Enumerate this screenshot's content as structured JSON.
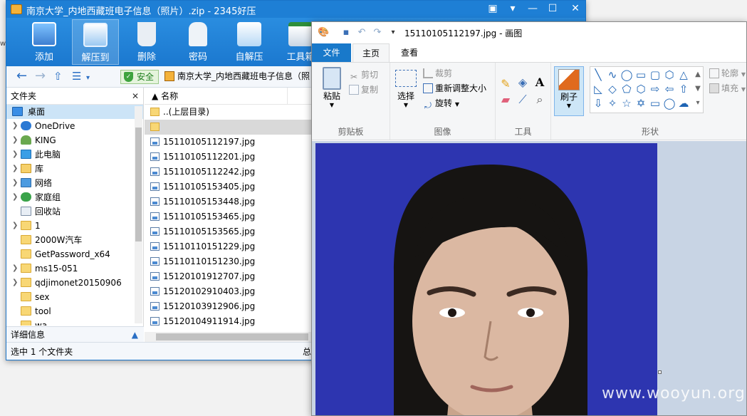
{
  "zip_window": {
    "title": "南京大学_内地西藏班电子信息（照片）.zip - 2345好压",
    "toolbar": [
      {
        "label": "添加",
        "icon": "add-icon"
      },
      {
        "label": "解压到",
        "icon": "extract-to-icon"
      },
      {
        "label": "删除",
        "icon": "delete-icon"
      },
      {
        "label": "密码",
        "icon": "lock-icon"
      },
      {
        "label": "自解压",
        "icon": "self-extract-icon"
      },
      {
        "label": "工具箱",
        "icon": "toolbox-icon"
      }
    ],
    "safe_label": "安全",
    "path": "南京大学_内地西藏班电子信息（照",
    "tree": {
      "header": "文件夹",
      "items": [
        {
          "label": "桌面",
          "icon": "desktop-icon",
          "selected": true
        },
        {
          "label": "OneDrive",
          "icon": "cloud-icon"
        },
        {
          "label": "KING",
          "icon": "user-icon"
        },
        {
          "label": "此电脑",
          "icon": "computer-icon"
        },
        {
          "label": "库",
          "icon": "library-icon"
        },
        {
          "label": "网络",
          "icon": "network-icon"
        },
        {
          "label": "家庭组",
          "icon": "homegroup-icon"
        },
        {
          "label": "回收站",
          "icon": "recycle-bin-icon"
        },
        {
          "label": "1",
          "icon": "folder-icon"
        },
        {
          "label": "2000W汽车",
          "icon": "folder-icon"
        },
        {
          "label": "GetPassword_x64",
          "icon": "folder-icon"
        },
        {
          "label": "ms15-051",
          "icon": "folder-icon"
        },
        {
          "label": "qdjimonet20150906",
          "icon": "folder-icon"
        },
        {
          "label": "sex",
          "icon": "folder-icon"
        },
        {
          "label": "tool",
          "icon": "folder-icon"
        },
        {
          "label": "wa",
          "icon": "folder-icon"
        }
      ],
      "footer": "详细信息"
    },
    "list": {
      "column_name": "名称",
      "parent_dir": "..(上层目录)",
      "files": [
        "15110105112197.jpg",
        "15110105112201.jpg",
        "15110105112242.jpg",
        "15110105153405.jpg",
        "15110105153448.jpg",
        "15110105153465.jpg",
        "15110105153565.jpg",
        "15110110151229.jpg",
        "15110110151230.jpg",
        "15120101912707.jpg",
        "15120102910403.jpg",
        "15120103912906.jpg",
        "15120104911914.jpg"
      ]
    },
    "status": "选中 1 个文件夹",
    "status_right": "总"
  },
  "paint_window": {
    "title": "15110105112197.jpg - 画图",
    "tabs": {
      "file": "文件",
      "home": "主页",
      "view": "查看"
    },
    "clipboard": {
      "paste": "粘贴",
      "cut": "剪切",
      "copy": "复制",
      "group": "剪贴板"
    },
    "image": {
      "select": "选择",
      "crop": "裁剪",
      "resize": "重新调整大小",
      "rotate": "旋转",
      "group": "图像"
    },
    "tools": {
      "group": "工具"
    },
    "brush": {
      "label": "刷子"
    },
    "shapes": {
      "outline": "轮廓",
      "fill": "填充",
      "group": "形状"
    }
  },
  "watermark": "www.wooyun.org",
  "colors": {
    "zip_accent": "#1e7fd5",
    "paint_file_tab": "#1979ca",
    "photo_background": "#2d35b0"
  }
}
